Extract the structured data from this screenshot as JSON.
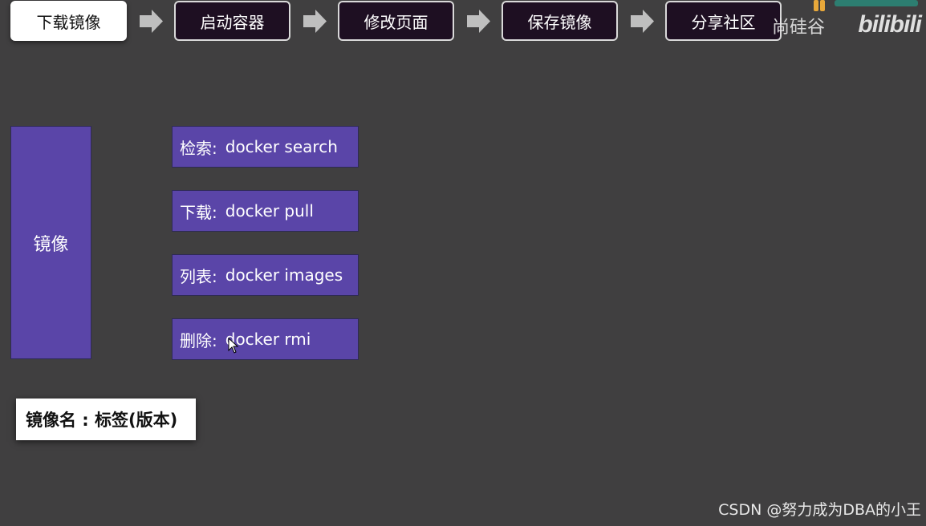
{
  "workflow": {
    "steps": [
      {
        "label": "下载镜像",
        "active": true
      },
      {
        "label": "启动容器",
        "active": false
      },
      {
        "label": "修改页面",
        "active": false
      },
      {
        "label": "保存镜像",
        "active": false
      },
      {
        "label": "分享社区",
        "active": false
      }
    ]
  },
  "watermark": {
    "text": "尚硅谷",
    "logo": "bilibili",
    "logo_icon": "atguigu-logo-icon"
  },
  "main": {
    "category": "镜像",
    "commands": [
      {
        "label": "检索:",
        "command": "docker search"
      },
      {
        "label": "下载:",
        "command": "docker pull"
      },
      {
        "label": "列表:",
        "command": "docker images"
      },
      {
        "label": "删除:",
        "command": "docker rmi"
      }
    ],
    "note": "镜像名 : 标签(版本)"
  },
  "footer": {
    "credit": "CSDN @努力成为DBA的小王"
  },
  "colors": {
    "background": "#403f40",
    "command_box": "#5a45a8",
    "step_box": "#1e0f22",
    "step_active": "#ffffff",
    "arrow": "#bfbfbf"
  }
}
